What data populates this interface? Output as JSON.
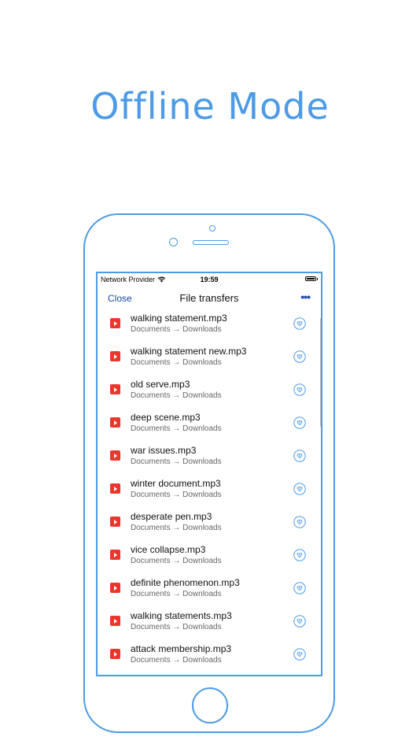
{
  "headline": "Offline Mode",
  "status": {
    "carrier": "Network Provider",
    "time": "19:59"
  },
  "nav": {
    "close_label": "Close",
    "title": "File transfers",
    "more_label": "•••"
  },
  "files": [
    {
      "name": "walking statement.mp3",
      "path": "Documents → Downloads"
    },
    {
      "name": "walking statement new.mp3",
      "path": "Documents → Downloads"
    },
    {
      "name": "old serve.mp3",
      "path": "Documents → Downloads"
    },
    {
      "name": "deep scene.mp3",
      "path": "Documents → Downloads"
    },
    {
      "name": "war issues.mp3",
      "path": "Documents → Downloads"
    },
    {
      "name": "winter document.mp3",
      "path": "Documents → Downloads"
    },
    {
      "name": "desperate pen.mp3",
      "path": "Documents → Downloads"
    },
    {
      "name": "vice collapse.mp3",
      "path": "Documents → Downloads"
    },
    {
      "name": "definite phenomenon.mp3",
      "path": "Documents → Downloads"
    },
    {
      "name": "walking statements.mp3",
      "path": "Documents → Downloads"
    },
    {
      "name": "attack membership.mp3",
      "path": "Documents → Downloads"
    }
  ],
  "colors": {
    "accent": "#4d9be6",
    "nav_link": "#1a49b3",
    "file_icon": "#e8382c"
  },
  "icons": {
    "file": "play-file-icon",
    "action": "download-circle-icon",
    "wifi": "wifi-icon",
    "battery": "battery-icon"
  }
}
